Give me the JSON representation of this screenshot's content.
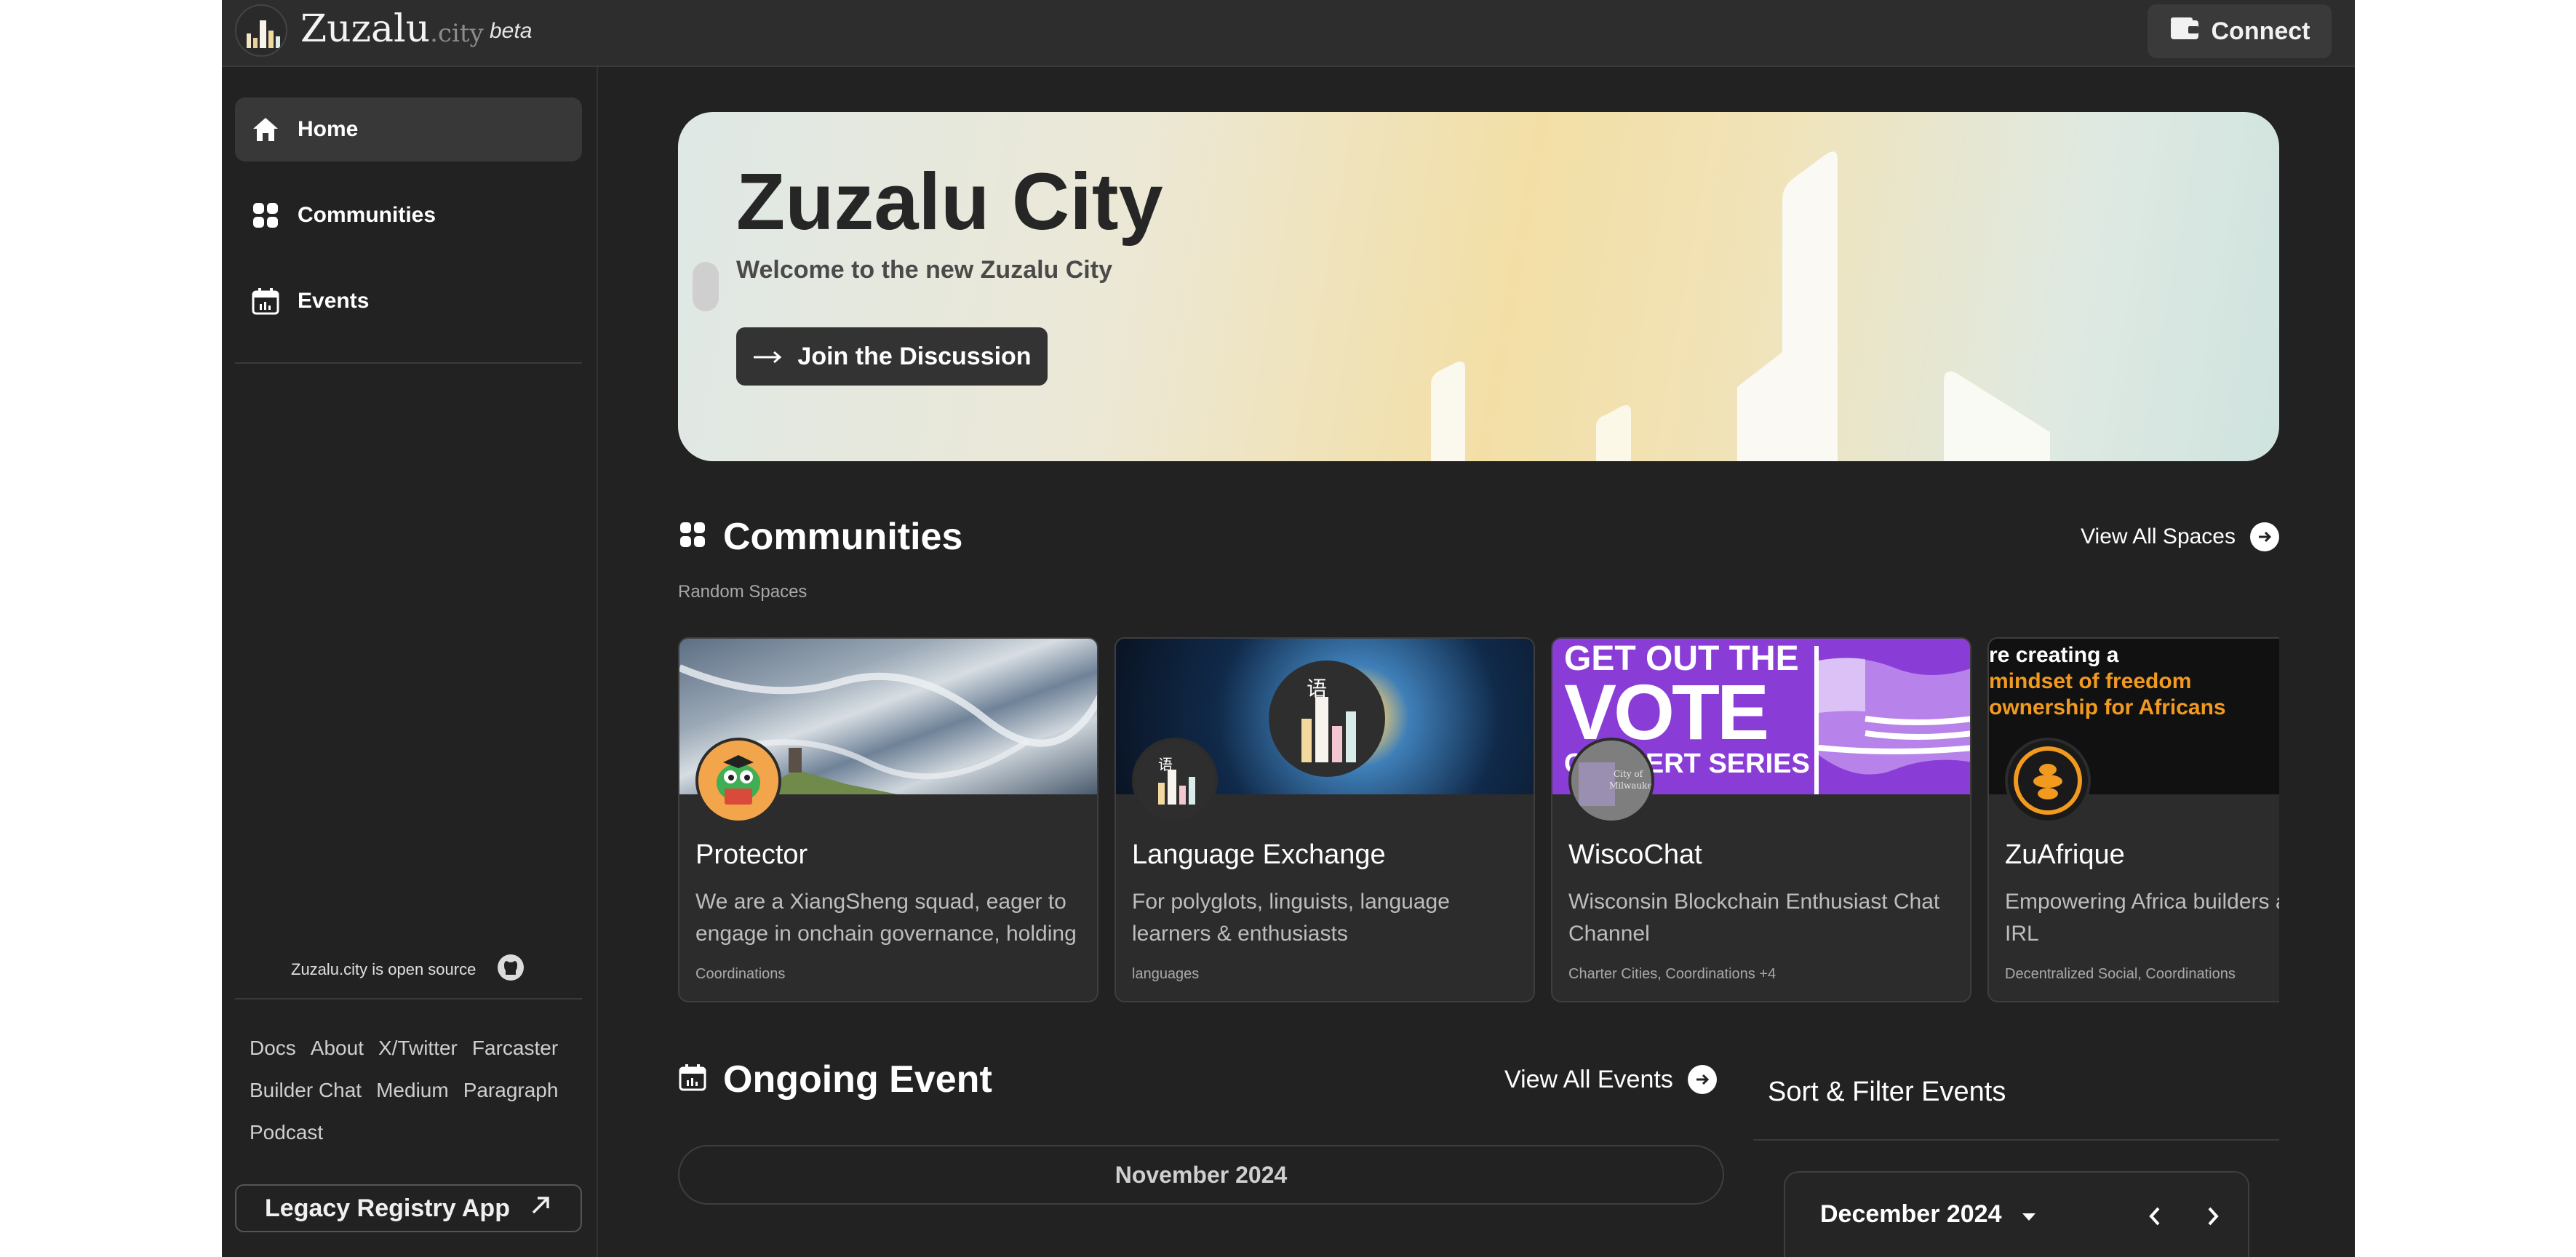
{
  "header": {
    "logo_name": "Zuzalu",
    "logo_suffix": ".city",
    "badge": "beta",
    "connect_label": "Connect"
  },
  "sidebar": {
    "items": [
      {
        "label": "Home",
        "icon": "home-icon",
        "active": true
      },
      {
        "label": "Communities",
        "icon": "grid-icon",
        "active": false
      },
      {
        "label": "Events",
        "icon": "calendar-icon",
        "active": false
      }
    ],
    "open_source_text": "Zuzalu.city is open source",
    "footer_links": [
      "Docs",
      "About",
      "X/Twitter",
      "Farcaster",
      "Builder Chat",
      "Medium",
      "Paragraph",
      "Podcast"
    ],
    "legacy_label": "Legacy Registry App"
  },
  "hero": {
    "title": "Zuzalu City",
    "subtitle": "Welcome to the new Zuzalu City",
    "button_label": "Join the Discussion"
  },
  "communities": {
    "title": "Communities",
    "view_all_label": "View All Spaces",
    "subtitle": "Random Spaces",
    "cards": [
      {
        "name": "Protector",
        "description": "We are a XiangSheng squad, eager to engage in onchain governance, holding",
        "tags": "Coordinations"
      },
      {
        "name": "Language Exchange",
        "description": "For polyglots, linguists, language learners & enthusiasts",
        "tags": "languages"
      },
      {
        "name": "WiscoChat",
        "description": "Wisconsin Blockchain Enthusiast Chat Channel",
        "tags": "Charter Cities, Coordinations +4",
        "banner_line1": "GET OUT THE",
        "banner_line2": "VOTE",
        "banner_line3": "CONCERT SERIES"
      },
      {
        "name": "ZuAfrique",
        "description": "Empowering Africa builders and vibe in IRL",
        "tags": "Decentralized Social, Coordinations",
        "banner_line1": "re creating a",
        "banner_line2": "mindset of freedom",
        "banner_line3": "ownership for Africans"
      }
    ]
  },
  "events": {
    "title": "Ongoing Event",
    "view_all_label": "View All Events",
    "month_label": "November 2024",
    "sort_title": "Sort & Filter Events",
    "calendar_month": "December 2024"
  },
  "colors": {
    "background": "#222222",
    "header": "#2d2d2d",
    "accent_orange": "#f29a1f",
    "vote_purple": "#8a3dd6"
  }
}
